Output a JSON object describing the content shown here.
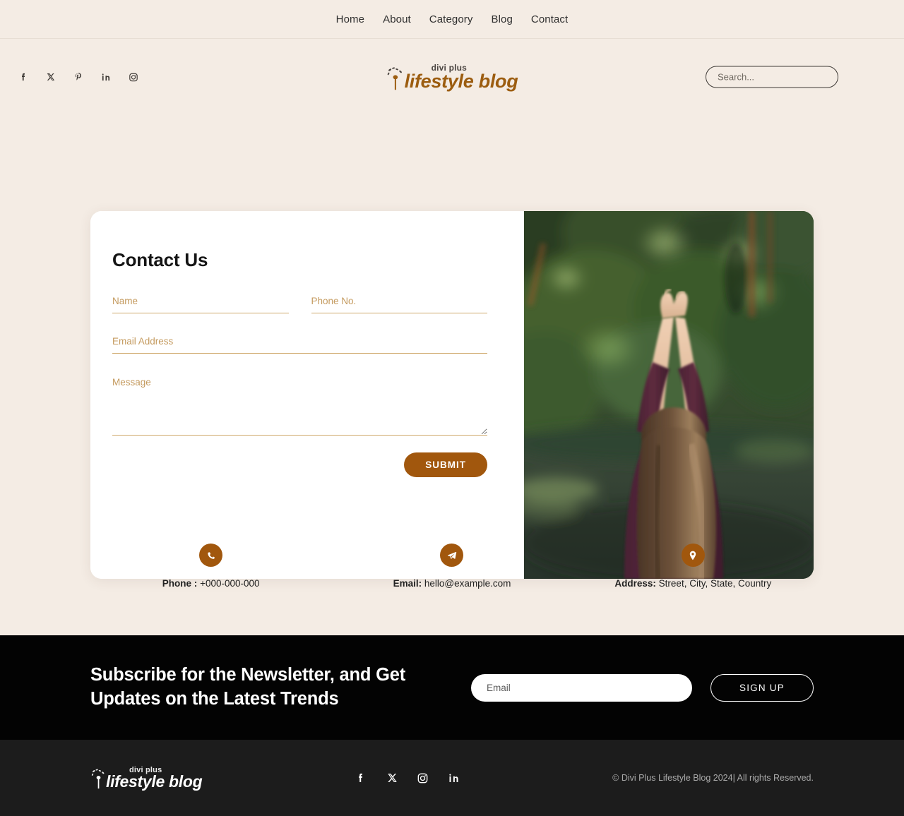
{
  "nav": {
    "items": [
      {
        "label": "Home"
      },
      {
        "label": "About"
      },
      {
        "label": "Category"
      },
      {
        "label": "Blog"
      },
      {
        "label": "Contact"
      }
    ]
  },
  "header": {
    "social": [
      {
        "name": "facebook-icon"
      },
      {
        "name": "x-twitter-icon"
      },
      {
        "name": "pinterest-icon"
      },
      {
        "name": "linkedin-icon"
      },
      {
        "name": "instagram-icon"
      }
    ],
    "logo": {
      "top_text": "divi plus",
      "main_text": "lifestyle blog",
      "color": "#9c5d10"
    },
    "search": {
      "placeholder": "Search...",
      "value": ""
    }
  },
  "contact_form": {
    "title": "Contact Us",
    "fields": {
      "name": {
        "placeholder": "Name",
        "value": ""
      },
      "phone": {
        "placeholder": "Phone No.",
        "value": ""
      },
      "email": {
        "placeholder": "Email Address",
        "value": ""
      },
      "message": {
        "placeholder": "Message",
        "value": ""
      }
    },
    "submit_label": "SUBMIT",
    "accent_color": "#a1570d",
    "underline_color": "#cfa86a"
  },
  "photo": {
    "alt": "Woman seen from behind with arms raised facing a forest lake"
  },
  "contact_info": [
    {
      "icon": "phone-icon",
      "label": "Phone :",
      "value": "+000-000-000"
    },
    {
      "icon": "paper-plane-icon",
      "label": "Email:",
      "value": "hello@example.com"
    },
    {
      "icon": "map-pin-icon",
      "label": "Address:",
      "value": "Street, City, State, Country"
    }
  ],
  "newsletter": {
    "heading": "Subscribe for the Newsletter, and Get Updates on the Latest Trends",
    "email_placeholder": "Email",
    "email_value": "",
    "signup_label": "SIGN UP",
    "background": "#030303"
  },
  "footer": {
    "logo": {
      "top_text": "divi plus",
      "main_text": "lifestyle blog"
    },
    "social": [
      {
        "name": "facebook-icon"
      },
      {
        "name": "x-twitter-icon"
      },
      {
        "name": "instagram-icon"
      },
      {
        "name": "linkedin-icon"
      }
    ],
    "copyright": "© Divi Plus Lifestyle Blog 2024| All rights Reserved.",
    "background": "#1c1c1c"
  }
}
